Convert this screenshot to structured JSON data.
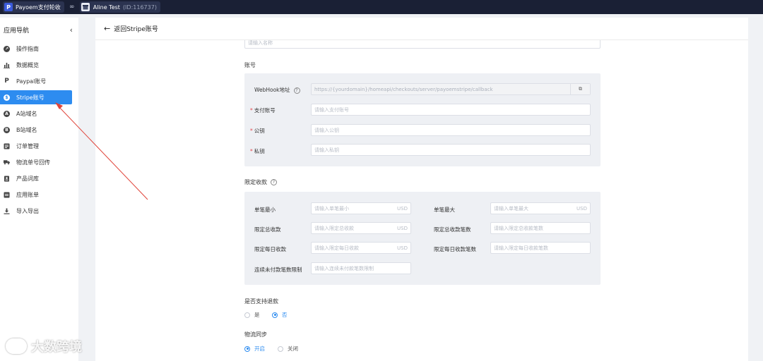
{
  "topbar": {
    "app_logo": "P",
    "app_name": "Payoem支付轮收",
    "store_name": "Aline Test",
    "store_id": "(ID:116737)"
  },
  "sidebar": {
    "title": "应用导航",
    "collapse_icon": "chevron-left",
    "items": [
      {
        "label": "操作指南",
        "icon": "compass-icon"
      },
      {
        "label": "数据概览",
        "icon": "bar-chart-icon"
      },
      {
        "label": "Paypal账号",
        "icon": "paypal-icon"
      },
      {
        "label": "Stripe账号",
        "icon": "stripe-icon",
        "active": true
      },
      {
        "label": "A站域名",
        "icon": "a-site-icon"
      },
      {
        "label": "B站域名",
        "icon": "b-site-icon"
      },
      {
        "label": "订单管理",
        "icon": "order-list-icon"
      },
      {
        "label": "物流单号回传",
        "icon": "truck-icon"
      },
      {
        "label": "产品词库",
        "icon": "product-book-icon"
      },
      {
        "label": "应用账单",
        "icon": "bill-icon"
      },
      {
        "label": "导入导出",
        "icon": "download-icon"
      }
    ]
  },
  "main": {
    "back_label": "返回Stripe账号",
    "name_placeholder": "请输入名称",
    "account": {
      "section_title": "账号",
      "webhook_label": "WebHook地址",
      "webhook_value": "https://{yourdomain}/homeapi/checkouts/server/payoemstripe/callback",
      "pay_account_label": "支付账号",
      "pay_account_placeholder": "请输入支付账号",
      "public_key_label": "公钥",
      "public_key_placeholder": "请输入公钥",
      "private_key_label": "私钥",
      "private_key_placeholder": "请输入私钥",
      "required_mark": "*"
    },
    "limits": {
      "section_title": "限定收款",
      "currency": "USD",
      "single_min_label": "单笔最小",
      "single_min_placeholder": "请输入单笔最小",
      "single_max_label": "单笔最大",
      "single_max_placeholder": "请输入单笔最大",
      "total_amount_label": "限定总收款",
      "total_amount_placeholder": "请输入限定总收款",
      "total_count_label": "限定总收款笔数",
      "total_count_placeholder": "请输入限定总收款笔数",
      "daily_amount_label": "限定每日收款",
      "daily_amount_placeholder": "请输入限定每日收款",
      "daily_count_label": "限定每日收款笔数",
      "daily_count_placeholder": "请输入限定每日收款笔数",
      "unpaid_label": "连续未付款笔数限制",
      "unpaid_placeholder": "请输入连续未付款笔数限制"
    },
    "refund": {
      "title": "是否支持退款",
      "options": [
        "是",
        "否"
      ],
      "selected": "否"
    },
    "logistics": {
      "title": "物流同步",
      "options": [
        "开启",
        "关闭"
      ],
      "selected": "开启"
    }
  },
  "watermark": "大数跨境"
}
